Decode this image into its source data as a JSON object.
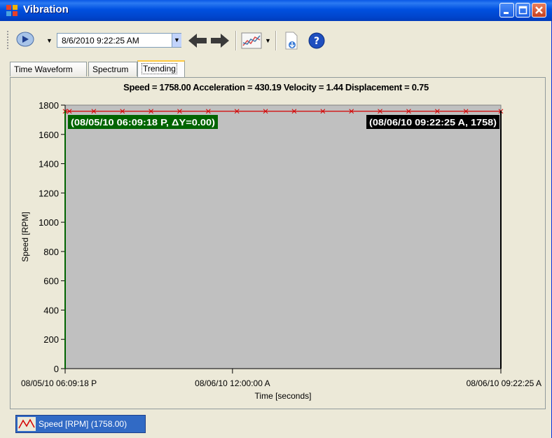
{
  "window": {
    "title": "Vibration"
  },
  "toolbar": {
    "datetime": "8/6/2010 9:22:25 AM",
    "icons": [
      "play-nav-icon",
      "dropdown-arrow-icon",
      "back-arrow-icon",
      "forward-arrow-icon",
      "chart-type-icon",
      "export-icon",
      "help-icon"
    ]
  },
  "tabs": [
    {
      "label": "Time Waveform",
      "active": false
    },
    {
      "label": "Spectrum",
      "active": false
    },
    {
      "label": "Trending",
      "active": true
    }
  ],
  "colors": {
    "plot_bg": "#c0c0c0",
    "series": "#d40000",
    "cursor_left": "#006400",
    "cursor_right": "#000000",
    "legend_bg": "#316ac5",
    "titlebar": "#0050e0"
  },
  "chart_data": {
    "type": "line",
    "title": "Speed = 1758.00 Acceleration = 430.19 Velocity = 1.44 Displacement = 0.75",
    "xlabel": "Time [seconds]",
    "ylabel": "Speed [RPM]",
    "x_tick_labels": [
      "08/05/10 06:09:18 P",
      "08/06/10 12:00:00 A",
      "08/06/10 09:22:25 A"
    ],
    "y_ticks": [
      0,
      200,
      400,
      600,
      800,
      1000,
      1200,
      1400,
      1600,
      1800
    ],
    "ylim": [
      0,
      1800
    ],
    "xlim_hours": [
      0,
      15.22
    ],
    "series": [
      {
        "name": "Speed [RPM]",
        "x_hours": [
          0,
          0.15,
          1.0,
          2.0,
          3.0,
          4.0,
          5.0,
          6.0,
          7.0,
          8.0,
          9.0,
          10.0,
          11.0,
          12.0,
          13.0,
          14.0,
          15.22
        ],
        "values": [
          1758,
          1758,
          1758,
          1758,
          1758,
          1758,
          1758,
          1758,
          1758,
          1758,
          1758,
          1758,
          1758,
          1758,
          1758,
          1758,
          1758
        ]
      }
    ],
    "cursors": [
      {
        "label": "(08/05/10 06:09:18 P, ΔY=0.00)",
        "x_hours": 0
      },
      {
        "label": "(08/06/10 09:22:25 A, 1758)",
        "x_hours": 15.22
      }
    ],
    "grid": false
  },
  "legend": {
    "label": "Speed [RPM] (1758.00)"
  }
}
